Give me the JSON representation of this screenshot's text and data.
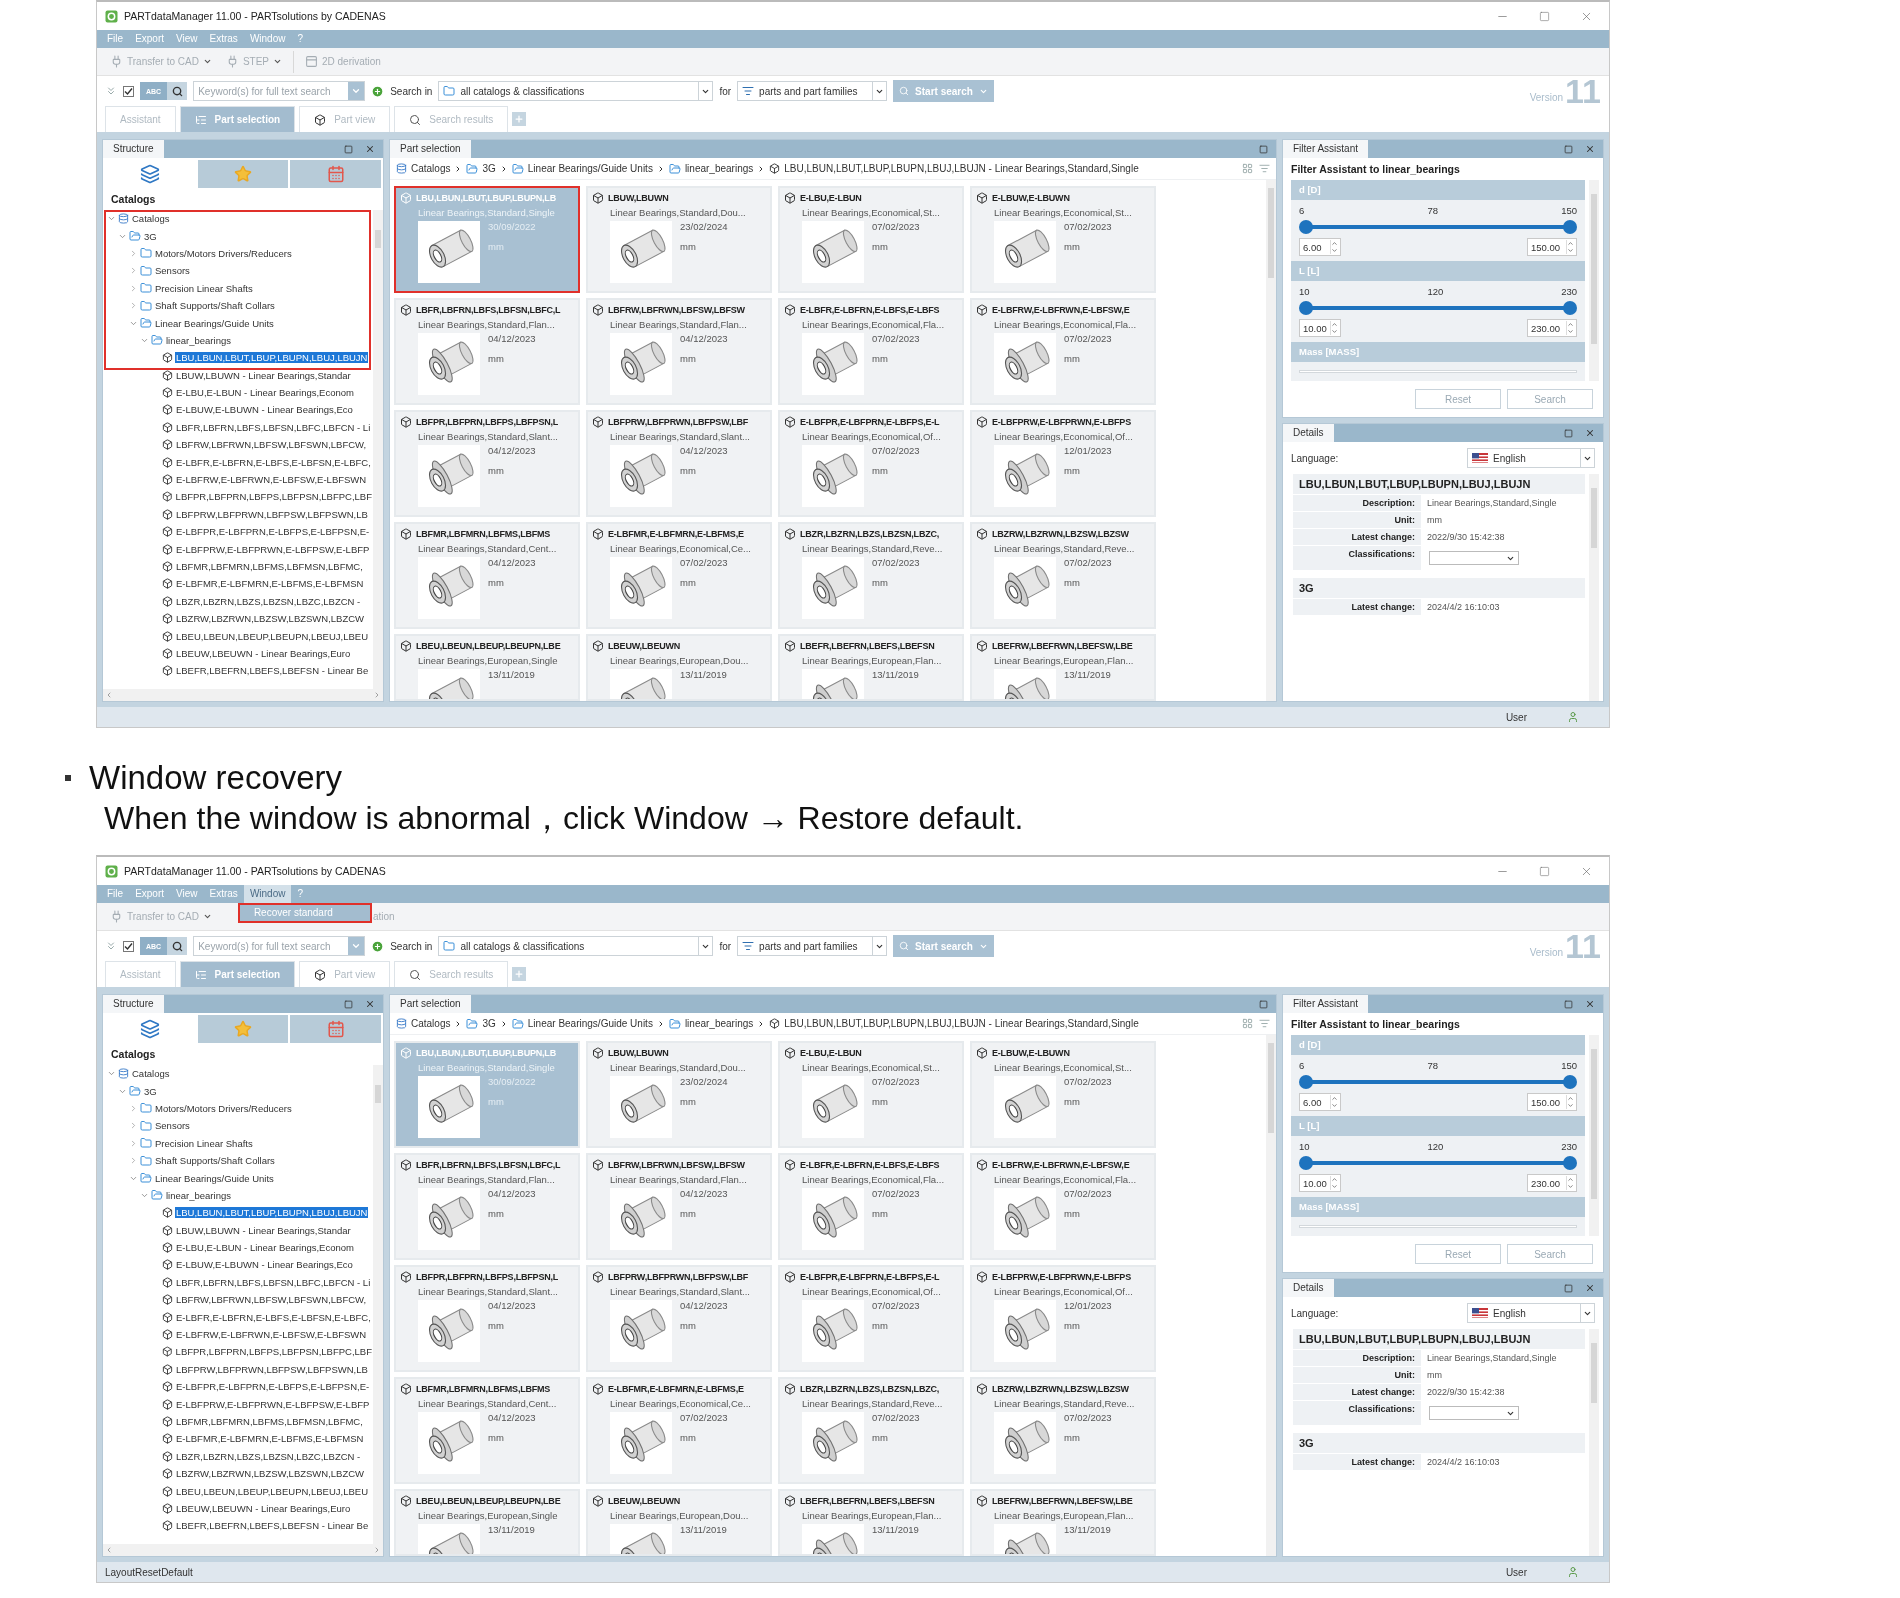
{
  "screenshot_1": {
    "window_title": "PARTdataManager 11.00 - PARTsolutions by CADENAS",
    "menu": [
      {
        "label": "File",
        "open": false
      },
      {
        "label": "Export",
        "open": false
      },
      {
        "label": "View",
        "open": false
      },
      {
        "label": "Extras",
        "open": false
      },
      {
        "label": "Window",
        "open": false
      },
      {
        "label": "?",
        "open": false
      }
    ],
    "toolbar": [
      {
        "label": "Transfer to CAD",
        "kind": "split"
      },
      {
        "label": "STEP",
        "kind": "split"
      },
      {
        "label": "2D derivation",
        "kind": "button"
      }
    ],
    "search": {
      "option_checked": true,
      "abc": "ABC",
      "abc_selected": true,
      "placeholder": "Keyword(s) for full text search",
      "search_in": "Search in",
      "scope": "all catalogs & classifications",
      "for": "for",
      "target": "parts and part families",
      "button": "Start search",
      "version_label": "Version",
      "version_number": "11"
    },
    "tabs": [
      {
        "label": "Assistant",
        "kind": "plain",
        "selected": false
      },
      {
        "label": "Part selection",
        "kind": "catalog",
        "selected": true
      },
      {
        "label": "Part view",
        "kind": "part",
        "selected": false
      },
      {
        "label": "Search results",
        "kind": "search",
        "selected": false
      }
    ],
    "structure": {
      "title": "Structure",
      "heading": "Catalogs",
      "outlined": true,
      "icon_tabs": [
        {
          "kind": "catalogs",
          "selected": true
        },
        {
          "kind": "favorites",
          "selected": false
        },
        {
          "kind": "history",
          "selected": false
        }
      ],
      "tree": [
        {
          "label": "Catalogs",
          "kind": "root",
          "expanded": true,
          "selected": false,
          "children": [
            {
              "label": "3G",
              "kind": "folder",
              "expanded": true,
              "selected": false,
              "children": [
                {
                  "label": "Motors/Motors Drivers/Reducers",
                  "kind": "folder",
                  "expanded": false,
                  "selected": false
                },
                {
                  "label": "Sensors",
                  "kind": "folder",
                  "expanded": false,
                  "selected": false
                },
                {
                  "label": "Precision Linear Shafts",
                  "kind": "folder",
                  "expanded": false,
                  "selected": false
                },
                {
                  "label": "Shaft Supports/Shaft Collars",
                  "kind": "folder",
                  "expanded": false,
                  "selected": false
                },
                {
                  "label": "Linear Bearings/Guide Units",
                  "kind": "folder",
                  "expanded": true,
                  "selected": false,
                  "children": [
                    {
                      "label": "linear_bearings",
                      "kind": "folder",
                      "expanded": true,
                      "selected": false,
                      "children": [
                        {
                          "label": "LBU,LBUN,LBUT,LBUP,LBUPN,LBUJ,LBUJN",
                          "kind": "part",
                          "selected": true
                        },
                        {
                          "label": "LBUW,LBUWN - Linear Bearings,Standar",
                          "kind": "part",
                          "selected": false
                        },
                        {
                          "label": "E-LBU,E-LBUN - Linear Bearings,Econom",
                          "kind": "part",
                          "selected": false
                        },
                        {
                          "label": "E-LBUW,E-LBUWN - Linear Bearings,Eco",
                          "kind": "part",
                          "selected": false
                        },
                        {
                          "label": "LBFR,LBFRN,LBFS,LBFSN,LBFC,LBFCN - Li",
                          "kind": "part",
                          "selected": false
                        },
                        {
                          "label": "LBFRW,LBFRWN,LBFSW,LBFSWN,LBFCW,",
                          "kind": "part",
                          "selected": false
                        },
                        {
                          "label": "E-LBFR,E-LBFRN,E-LBFS,E-LBFSN,E-LBFC,",
                          "kind": "part",
                          "selected": false
                        },
                        {
                          "label": "E-LBFRW,E-LBFRWN,E-LBFSW,E-LBFSWN",
                          "kind": "part",
                          "selected": false
                        },
                        {
                          "label": "LBFPR,LBFPRN,LBFPS,LBFPSN,LBFPC,LBF",
                          "kind": "part",
                          "selected": false
                        },
                        {
                          "label": "LBFPRW,LBFPRWN,LBFPSW,LBFPSWN,LB",
                          "kind": "part",
                          "selected": false
                        },
                        {
                          "label": "E-LBFPR,E-LBFPRN,E-LBFPS,E-LBFPSN,E-",
                          "kind": "part",
                          "selected": false
                        },
                        {
                          "label": "E-LBFPRW,E-LBFPRWN,E-LBFPSW,E-LBFP",
                          "kind": "part",
                          "selected": false
                        },
                        {
                          "label": "LBFMR,LBFMRN,LBFMS,LBFMSN,LBFMC,",
                          "kind": "part",
                          "selected": false
                        },
                        {
                          "label": "E-LBFMR,E-LBFMRN,E-LBFMS,E-LBFMSN",
                          "kind": "part",
                          "selected": false
                        },
                        {
                          "label": "LBZR,LBZRN,LBZS,LBZSN,LBZC,LBZCN -",
                          "kind": "part",
                          "selected": false
                        },
                        {
                          "label": "LBZRW,LBZRWN,LBZSW,LBZSWN,LBZCW",
                          "kind": "part",
                          "selected": false
                        },
                        {
                          "label": "LBEU,LBEUN,LBEUP,LBEUPN,LBEUJ,LBEU",
                          "kind": "part",
                          "selected": false
                        },
                        {
                          "label": "LBEUW,LBEUWN - Linear Bearings,Euro",
                          "kind": "part",
                          "selected": false
                        },
                        {
                          "label": "LBEFR,LBEFRN,LBEFS,LBEFSN - Linear Be",
                          "kind": "part",
                          "selected": false
                        }
                      ]
                    }
                  ]
                }
              ]
            }
          ]
        }
      ]
    },
    "part_selection": {
      "title": "Part selection",
      "breadcrumb": [
        {
          "label": "Catalogs",
          "kind": "root"
        },
        {
          "label": "3G",
          "kind": "folder"
        },
        {
          "label": "Linear Bearings/Guide Units",
          "kind": "folder"
        },
        {
          "label": "linear_bearings",
          "kind": "folder"
        },
        {
          "label": "LBU,LBUN,LBUT,LBUP,LBUPN,LBUJ,LBUJN - Linear Bearings,Standard,Single",
          "kind": "part"
        }
      ],
      "cards": [
        {
          "title": "LBU,LBUN,LBUT,LBUP,LBUPN,LB",
          "subtitle": "Linear Bearings,Standard,Single",
          "date": "30/09/2022",
          "unit": "mm",
          "kind": "sleeve",
          "selected": true,
          "outlined": true
        },
        {
          "title": "LBUW,LBUWN",
          "subtitle": "Linear Bearings,Standard,Dou...",
          "date": "23/02/2024",
          "unit": "mm",
          "kind": "sleeve",
          "selected": false,
          "outlined": false
        },
        {
          "title": "E-LBU,E-LBUN",
          "subtitle": "Linear Bearings,Economical,St...",
          "date": "07/02/2023",
          "unit": "mm",
          "kind": "sleeve",
          "selected": false,
          "outlined": false
        },
        {
          "title": "E-LBUW,E-LBUWN",
          "subtitle": "Linear Bearings,Economical,St...",
          "date": "07/02/2023",
          "unit": "mm",
          "kind": "sleeve",
          "selected": false,
          "outlined": false
        },
        {
          "title": "LBFR,LBFRN,LBFS,LBFSN,LBFC,L",
          "subtitle": "Linear Bearings,Standard,Flan...",
          "date": "04/12/2023",
          "unit": "mm",
          "kind": "flange",
          "selected": false,
          "outlined": false
        },
        {
          "title": "LBFRW,LBFRWN,LBFSW,LBFSW",
          "subtitle": "Linear Bearings,Standard,Flan...",
          "date": "04/12/2023",
          "unit": "mm",
          "kind": "flange",
          "selected": false,
          "outlined": false
        },
        {
          "title": "E-LBFR,E-LBFRN,E-LBFS,E-LBFS",
          "subtitle": "Linear Bearings,Economical,Fla...",
          "date": "07/02/2023",
          "unit": "mm",
          "kind": "flange",
          "selected": false,
          "outlined": false
        },
        {
          "title": "E-LBFRW,E-LBFRWN,E-LBFSW,E",
          "subtitle": "Linear Bearings,Economical,Fla...",
          "date": "07/02/2023",
          "unit": "mm",
          "kind": "flange",
          "selected": false,
          "outlined": false
        },
        {
          "title": "LBFPR,LBFPRN,LBFPS,LBFPSN,L",
          "subtitle": "Linear Bearings,Standard,Slant...",
          "date": "04/12/2023",
          "unit": "mm",
          "kind": "flange",
          "selected": false,
          "outlined": false
        },
        {
          "title": "LBFPRW,LBFPRWN,LBFPSW,LBF",
          "subtitle": "Linear Bearings,Standard,Slant...",
          "date": "04/12/2023",
          "unit": "mm",
          "kind": "flange",
          "selected": false,
          "outlined": false
        },
        {
          "title": "E-LBFPR,E-LBFPRN,E-LBFPS,E-L",
          "subtitle": "Linear Bearings,Economical,Of...",
          "date": "07/02/2023",
          "unit": "mm",
          "kind": "flange",
          "selected": false,
          "outlined": false
        },
        {
          "title": "E-LBFPRW,E-LBFPRWN,E-LBFPS",
          "subtitle": "Linear Bearings,Economical,Of...",
          "date": "12/01/2023",
          "unit": "mm",
          "kind": "flange",
          "selected": false,
          "outlined": false
        },
        {
          "title": "LBFMR,LBFMRN,LBFMS,LBFMS",
          "subtitle": "Linear Bearings,Standard,Cent...",
          "date": "04/12/2023",
          "unit": "mm",
          "kind": "flange",
          "selected": false,
          "outlined": false
        },
        {
          "title": "E-LBFMR,E-LBFMRN,E-LBFMS,E",
          "subtitle": "Linear Bearings,Economical,Ce...",
          "date": "07/02/2023",
          "unit": "mm",
          "kind": "flange",
          "selected": false,
          "outlined": false
        },
        {
          "title": "LBZR,LBZRN,LBZS,LBZSN,LBZC,",
          "subtitle": "Linear Bearings,Standard,Reve...",
          "date": "07/02/2023",
          "unit": "mm",
          "kind": "flange",
          "selected": false,
          "outlined": false
        },
        {
          "title": "LBZRW,LBZRWN,LBZSW,LBZSW",
          "subtitle": "Linear Bearings,Standard,Reve...",
          "date": "07/02/2023",
          "unit": "mm",
          "kind": "flange",
          "selected": false,
          "outlined": false
        },
        {
          "title": "LBEU,LBEUN,LBEUP,LBEUPN,LBE",
          "subtitle": "Linear Bearings,European,Single",
          "date": "13/11/2019",
          "kind": "sleeve",
          "selected": false,
          "outlined": false
        },
        {
          "title": "LBEUW,LBEUWN",
          "subtitle": "Linear Bearings,European,Dou...",
          "date": "13/11/2019",
          "kind": "sleeve",
          "selected": false,
          "outlined": false
        },
        {
          "title": "LBEFR,LBEFRN,LBEFS,LBEFSN",
          "subtitle": "Linear Bearings,European,Flan...",
          "date": "13/11/2019",
          "kind": "flange",
          "selected": false,
          "outlined": false
        },
        {
          "title": "LBEFRW,LBEFRWN,LBEFSW,LBE",
          "subtitle": "Linear Bearings,European,Flan...",
          "date": "13/11/2019",
          "kind": "flange",
          "selected": false,
          "outlined": false
        }
      ]
    },
    "filter": {
      "title": "Filter Assistant",
      "heading": "Filter Assistant to linear_bearings",
      "params": [
        {
          "name": "d [D]",
          "kind": "range",
          "ticks": [
            "6",
            "78",
            "150"
          ],
          "thumbs": [
            {
              "level": 0
            },
            {
              "level": 1
            }
          ],
          "min": "6.00",
          "max": "150.00"
        },
        {
          "name": "L [L]",
          "kind": "range",
          "ticks": [
            "10",
            "120",
            "230"
          ],
          "thumbs": [
            {
              "level": 0
            },
            {
              "level": 1
            }
          ],
          "min": "10.00",
          "max": "230.00"
        },
        {
          "name": "Mass [MASS]",
          "kind": "text"
        }
      ],
      "buttons": [
        "Reset",
        "Search"
      ]
    },
    "details": {
      "title": "Details",
      "language_label": "Language:",
      "language": "English",
      "groups": [
        {
          "title": "LBU,LBUN,LBUT,LBUP,LBUPN,LBUJ,LBUJN",
          "rows": [
            {
              "label": "Description:",
              "value": "Linear Bearings,Standard,Single",
              "kind": "text"
            },
            {
              "label": "Unit:",
              "value": "mm",
              "kind": "text"
            },
            {
              "label": "Latest change:",
              "value": "2022/9/30 15:42:38",
              "kind": "text"
            },
            {
              "label": "Classifications:",
              "kind": "select"
            }
          ]
        },
        {
          "title": "3G",
          "rows": [
            {
              "label": "Latest change:",
              "value": "2024/4/2 16:10:03",
              "kind": "text"
            }
          ]
        }
      ]
    },
    "status": {
      "user": "User"
    }
  },
  "section": {
    "title": "Window recovery",
    "text": "When the window is abnormal，click Window → Restore default."
  },
  "screenshot_2": {
    "window_title": "PARTdataManager 11.00 - PARTsolutions by CADENAS",
    "menu": [
      {
        "label": "File",
        "open": false
      },
      {
        "label": "Export",
        "open": false
      },
      {
        "label": "View",
        "open": false
      },
      {
        "label": "Extras",
        "open": false
      },
      {
        "label": "Window",
        "open": true,
        "popup": [
          {
            "label": "Recover standard",
            "highlighted": true,
            "outlined": true
          }
        ]
      },
      {
        "label": "?",
        "open": false
      }
    ],
    "toolbar": [
      {
        "label": "Transfer to CAD",
        "kind": "split"
      },
      {
        "label": "ation",
        "kind": "fragment"
      }
    ],
    "search": {
      "option_checked": true,
      "abc": "ABC",
      "abc_selected": true,
      "placeholder": "Keyword(s) for full text search",
      "search_in": "Search in",
      "scope": "all catalogs & classifications",
      "for": "for",
      "target": "parts and part families",
      "button": "Start search",
      "version_label": "Version",
      "version_number": "11"
    },
    "tabs": [
      {
        "label": "Assistant",
        "kind": "plain",
        "selected": false
      },
      {
        "label": "Part selection",
        "kind": "catalog",
        "selected": true
      },
      {
        "label": "Part view",
        "kind": "part",
        "selected": false
      },
      {
        "label": "Search results",
        "kind": "search",
        "selected": false
      }
    ],
    "structure": {
      "title": "Structure",
      "heading": "Catalogs",
      "outlined": false,
      "icon_tabs": [
        {
          "kind": "catalogs",
          "selected": true
        },
        {
          "kind": "favorites",
          "selected": false
        },
        {
          "kind": "history",
          "selected": false
        }
      ],
      "tree": [
        {
          "label": "Catalogs",
          "kind": "root",
          "expanded": true,
          "selected": false,
          "children": [
            {
              "label": "3G",
              "kind": "folder",
              "expanded": true,
              "selected": false,
              "children": [
                {
                  "label": "Motors/Motors Drivers/Reducers",
                  "kind": "folder",
                  "expanded": false,
                  "selected": false
                },
                {
                  "label": "Sensors",
                  "kind": "folder",
                  "expanded": false,
                  "selected": false
                },
                {
                  "label": "Precision Linear Shafts",
                  "kind": "folder",
                  "expanded": false,
                  "selected": false
                },
                {
                  "label": "Shaft Supports/Shaft Collars",
                  "kind": "folder",
                  "expanded": false,
                  "selected": false
                },
                {
                  "label": "Linear Bearings/Guide Units",
                  "kind": "folder",
                  "expanded": true,
                  "selected": false,
                  "children": [
                    {
                      "label": "linear_bearings",
                      "kind": "folder",
                      "expanded": true,
                      "selected": false,
                      "children": [
                        {
                          "label": "LBU,LBUN,LBUT,LBUP,LBUPN,LBUJ,LBUJN",
                          "kind": "part",
                          "selected": true
                        },
                        {
                          "label": "LBUW,LBUWN - Linear Bearings,Standar",
                          "kind": "part",
                          "selected": false
                        },
                        {
                          "label": "E-LBU,E-LBUN - Linear Bearings,Econom",
                          "kind": "part",
                          "selected": false
                        },
                        {
                          "label": "E-LBUW,E-LBUWN - Linear Bearings,Eco",
                          "kind": "part",
                          "selected": false
                        },
                        {
                          "label": "LBFR,LBFRN,LBFS,LBFSN,LBFC,LBFCN - Li",
                          "kind": "part",
                          "selected": false
                        },
                        {
                          "label": "LBFRW,LBFRWN,LBFSW,LBFSWN,LBFCW,",
                          "kind": "part",
                          "selected": false
                        },
                        {
                          "label": "E-LBFR,E-LBFRN,E-LBFS,E-LBFSN,E-LBFC,",
                          "kind": "part",
                          "selected": false
                        },
                        {
                          "label": "E-LBFRW,E-LBFRWN,E-LBFSW,E-LBFSWN",
                          "kind": "part",
                          "selected": false
                        },
                        {
                          "label": "LBFPR,LBFPRN,LBFPS,LBFPSN,LBFPC,LBF",
                          "kind": "part",
                          "selected": false
                        },
                        {
                          "label": "LBFPRW,LBFPRWN,LBFPSW,LBFPSWN,LB",
                          "kind": "part",
                          "selected": false
                        },
                        {
                          "label": "E-LBFPR,E-LBFPRN,E-LBFPS,E-LBFPSN,E-",
                          "kind": "part",
                          "selected": false
                        },
                        {
                          "label": "E-LBFPRW,E-LBFPRWN,E-LBFPSW,E-LBFP",
                          "kind": "part",
                          "selected": false
                        },
                        {
                          "label": "LBFMR,LBFMRN,LBFMS,LBFMSN,LBFMC,",
                          "kind": "part",
                          "selected": false
                        },
                        {
                          "label": "E-LBFMR,E-LBFMRN,E-LBFMS,E-LBFMSN",
                          "kind": "part",
                          "selected": false
                        },
                        {
                          "label": "LBZR,LBZRN,LBZS,LBZSN,LBZC,LBZCN -",
                          "kind": "part",
                          "selected": false
                        },
                        {
                          "label": "LBZRW,LBZRWN,LBZSW,LBZSWN,LBZCW",
                          "kind": "part",
                          "selected": false
                        },
                        {
                          "label": "LBEU,LBEUN,LBEUP,LBEUPN,LBEUJ,LBEU",
                          "kind": "part",
                          "selected": false
                        },
                        {
                          "label": "LBEUW,LBEUWN - Linear Bearings,Euro",
                          "kind": "part",
                          "selected": false
                        },
                        {
                          "label": "LBEFR,LBEFRN,LBEFS,LBEFSN - Linear Be",
                          "kind": "part",
                          "selected": false
                        }
                      ]
                    }
                  ]
                }
              ]
            }
          ]
        }
      ]
    },
    "part_selection": {
      "title": "Part selection",
      "breadcrumb": [
        {
          "label": "Catalogs",
          "kind": "root"
        },
        {
          "label": "3G",
          "kind": "folder"
        },
        {
          "label": "Linear Bearings/Guide Units",
          "kind": "folder"
        },
        {
          "label": "linear_bearings",
          "kind": "folder"
        },
        {
          "label": "LBU,LBUN,LBUT,LBUP,LBUPN,LBUJ,LBUJN - Linear Bearings,Standard,Single",
          "kind": "part"
        }
      ],
      "cards": [
        {
          "title": "LBU,LBUN,LBUT,LBUP,LBUPN,LB",
          "subtitle": "Linear Bearings,Standard,Single",
          "date": "30/09/2022",
          "unit": "mm",
          "kind": "sleeve",
          "selected": true,
          "outlined": false
        },
        {
          "title": "LBUW,LBUWN",
          "subtitle": "Linear Bearings,Standard,Dou...",
          "date": "23/02/2024",
          "unit": "mm",
          "kind": "sleeve",
          "selected": false,
          "outlined": false
        },
        {
          "title": "E-LBU,E-LBUN",
          "subtitle": "Linear Bearings,Economical,St...",
          "date": "07/02/2023",
          "unit": "mm",
          "kind": "sleeve",
          "selected": false,
          "outlined": false
        },
        {
          "title": "E-LBUW,E-LBUWN",
          "subtitle": "Linear Bearings,Economical,St...",
          "date": "07/02/2023",
          "unit": "mm",
          "kind": "sleeve",
          "selected": false,
          "outlined": false
        },
        {
          "title": "LBFR,LBFRN,LBFS,LBFSN,LBFC,L",
          "subtitle": "Linear Bearings,Standard,Flan...",
          "date": "04/12/2023",
          "unit": "mm",
          "kind": "flange",
          "selected": false,
          "outlined": false
        },
        {
          "title": "LBFRW,LBFRWN,LBFSW,LBFSW",
          "subtitle": "Linear Bearings,Standard,Flan...",
          "date": "04/12/2023",
          "unit": "mm",
          "kind": "flange",
          "selected": false,
          "outlined": false
        },
        {
          "title": "E-LBFR,E-LBFRN,E-LBFS,E-LBFS",
          "subtitle": "Linear Bearings,Economical,Fla...",
          "date": "07/02/2023",
          "unit": "mm",
          "kind": "flange",
          "selected": false,
          "outlined": false
        },
        {
          "title": "E-LBFRW,E-LBFRWN,E-LBFSW,E",
          "subtitle": "Linear Bearings,Economical,Fla...",
          "date": "07/02/2023",
          "unit": "mm",
          "kind": "flange",
          "selected": false,
          "outlined": false
        },
        {
          "title": "LBFPR,LBFPRN,LBFPS,LBFPSN,L",
          "subtitle": "Linear Bearings,Standard,Slant...",
          "date": "04/12/2023",
          "unit": "mm",
          "kind": "flange",
          "selected": false,
          "outlined": false
        },
        {
          "title": "LBFPRW,LBFPRWN,LBFPSW,LBF",
          "subtitle": "Linear Bearings,Standard,Slant...",
          "date": "04/12/2023",
          "unit": "mm",
          "kind": "flange",
          "selected": false,
          "outlined": false
        },
        {
          "title": "E-LBFPR,E-LBFPRN,E-LBFPS,E-L",
          "subtitle": "Linear Bearings,Economical,Of...",
          "date": "07/02/2023",
          "unit": "mm",
          "kind": "flange",
          "selected": false,
          "outlined": false
        },
        {
          "title": "E-LBFPRW,E-LBFPRWN,E-LBFPS",
          "subtitle": "Linear Bearings,Economical,Of...",
          "date": "12/01/2023",
          "unit": "mm",
          "kind": "flange",
          "selected": false,
          "outlined": false
        },
        {
          "title": "LBFMR,LBFMRN,LBFMS,LBFMS",
          "subtitle": "Linear Bearings,Standard,Cent...",
          "date": "04/12/2023",
          "unit": "mm",
          "kind": "flange",
          "selected": false,
          "outlined": false
        },
        {
          "title": "E-LBFMR,E-LBFMRN,E-LBFMS,E",
          "subtitle": "Linear Bearings,Economical,Ce...",
          "date": "07/02/2023",
          "unit": "mm",
          "kind": "flange",
          "selected": false,
          "outlined": false
        },
        {
          "title": "LBZR,LBZRN,LBZS,LBZSN,LBZC,",
          "subtitle": "Linear Bearings,Standard,Reve...",
          "date": "07/02/2023",
          "unit": "mm",
          "kind": "flange",
          "selected": false,
          "outlined": false
        },
        {
          "title": "LBZRW,LBZRWN,LBZSW,LBZSW",
          "subtitle": "Linear Bearings,Standard,Reve...",
          "date": "07/02/2023",
          "unit": "mm",
          "kind": "flange",
          "selected": false,
          "outlined": false
        },
        {
          "title": "LBEU,LBEUN,LBEUP,LBEUPN,LBE",
          "subtitle": "Linear Bearings,European,Single",
          "date": "13/11/2019",
          "kind": "sleeve",
          "selected": false,
          "outlined": false
        },
        {
          "title": "LBEUW,LBEUWN",
          "subtitle": "Linear Bearings,European,Dou...",
          "date": "13/11/2019",
          "kind": "sleeve",
          "selected": false,
          "outlined": false
        },
        {
          "title": "LBEFR,LBEFRN,LBEFS,LBEFSN",
          "subtitle": "Linear Bearings,European,Flan...",
          "date": "13/11/2019",
          "kind": "flange",
          "selected": false,
          "outlined": false
        },
        {
          "title": "LBEFRW,LBEFRWN,LBEFSW,LBE",
          "subtitle": "Linear Bearings,European,Flan...",
          "date": "13/11/2019",
          "kind": "flange",
          "selected": false,
          "outlined": false
        }
      ]
    },
    "filter": {
      "title": "Filter Assistant",
      "heading": "Filter Assistant to linear_bearings",
      "params": [
        {
          "name": "d [D]",
          "kind": "range",
          "ticks": [
            "6",
            "78",
            "150"
          ],
          "thumbs": [
            {
              "level": 0
            },
            {
              "level": 1
            }
          ],
          "min": "6.00",
          "max": "150.00"
        },
        {
          "name": "L [L]",
          "kind": "range",
          "ticks": [
            "10",
            "120",
            "230"
          ],
          "thumbs": [
            {
              "level": 0
            },
            {
              "level": 1
            }
          ],
          "min": "10.00",
          "max": "230.00"
        },
        {
          "name": "Mass [MASS]",
          "kind": "text"
        }
      ],
      "buttons": [
        "Reset",
        "Search"
      ]
    },
    "details": {
      "title": "Details",
      "language_label": "Language:",
      "language": "English",
      "groups": [
        {
          "title": "LBU,LBUN,LBUT,LBUP,LBUPN,LBUJ,LBUJN",
          "rows": [
            {
              "label": "Description:",
              "value": "Linear Bearings,Standard,Single",
              "kind": "text"
            },
            {
              "label": "Unit:",
              "value": "mm",
              "kind": "text"
            },
            {
              "label": "Latest change:",
              "value": "2022/9/30 15:42:38",
              "kind": "text"
            },
            {
              "label": "Classifications:",
              "kind": "select"
            }
          ]
        },
        {
          "title": "3G",
          "rows": [
            {
              "label": "Latest change:",
              "value": "2024/4/2 16:10:03",
              "kind": "text"
            }
          ]
        }
      ]
    },
    "status": {
      "message": "LayoutResetDefault",
      "user": "User"
    }
  }
}
